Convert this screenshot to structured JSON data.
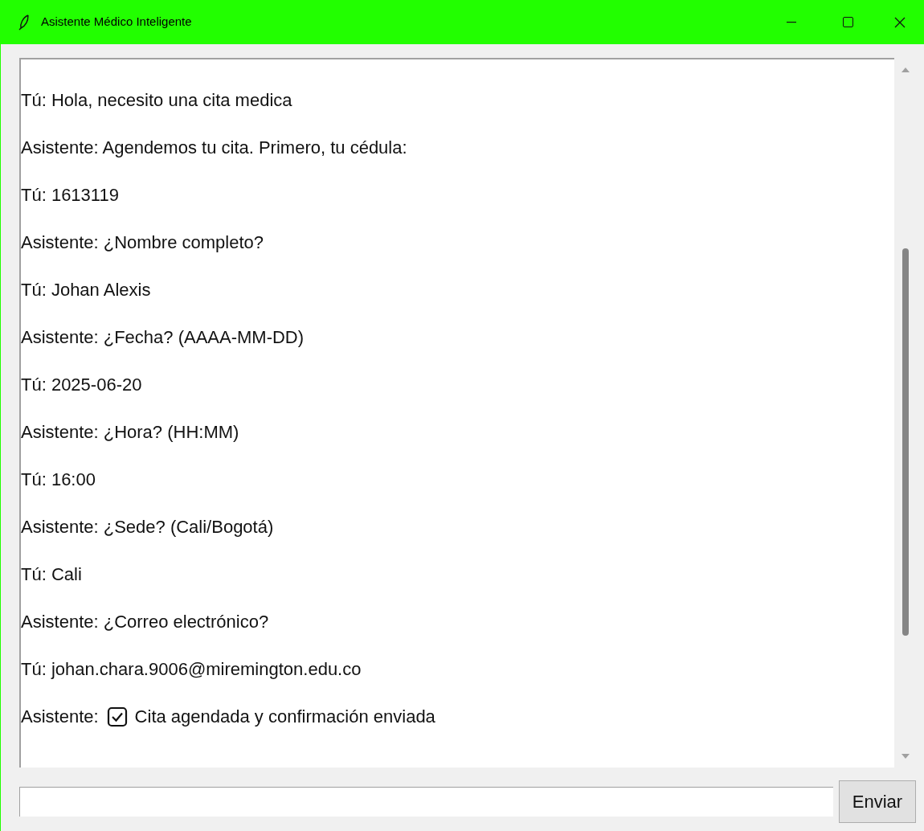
{
  "window": {
    "title": "Asistente Médico Inteligente"
  },
  "messages": [
    {
      "kind": "text",
      "text": "Tú: Hola, necesito una cita medica"
    },
    {
      "kind": "text",
      "text": "Asistente: Agendemos tu cita. Primero, tu cédula:"
    },
    {
      "kind": "text",
      "text": "Tú: 1613119"
    },
    {
      "kind": "text",
      "text": "Asistente: ¿Nombre completo?"
    },
    {
      "kind": "text",
      "text": "Tú: Johan Alexis"
    },
    {
      "kind": "text",
      "text": "Asistente: ¿Fecha? (AAAA-MM-DD)"
    },
    {
      "kind": "text",
      "text": "Tú: 2025-06-20"
    },
    {
      "kind": "text",
      "text": "Asistente: ¿Hora? (HH:MM)"
    },
    {
      "kind": "text",
      "text": "Tú: 16:00"
    },
    {
      "kind": "text",
      "text": "Asistente: ¿Sede? (Cali/Bogotá)"
    },
    {
      "kind": "text",
      "text": "Tú: Cali"
    },
    {
      "kind": "text",
      "text": "Asistente: ¿Correo electrónico?"
    },
    {
      "kind": "text",
      "text": "Tú: johan.chara.9006@miremington.edu.co"
    },
    {
      "kind": "confirmation",
      "prefix": "Asistente:",
      "text": "Cita agendada y confirmación enviada"
    }
  ],
  "send_button": {
    "label": "Enviar"
  }
}
